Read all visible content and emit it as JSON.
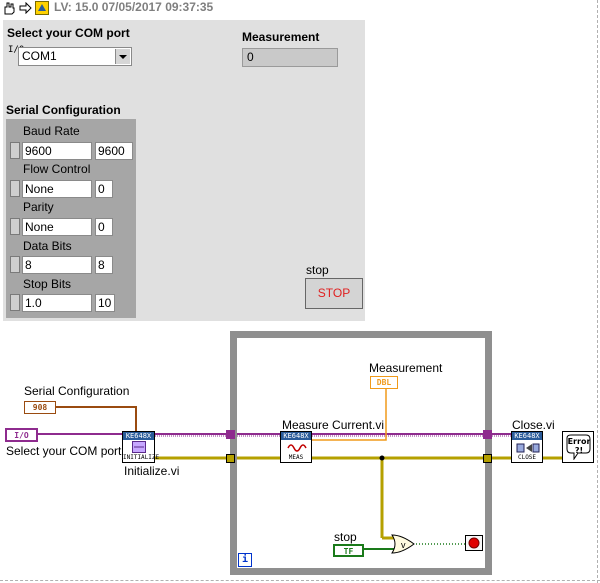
{
  "toolbar": {
    "version_label": "LV: 15.0 07/05/2017 09:37:35"
  },
  "front_panel": {
    "com_port": {
      "label": "Select your COM port",
      "prefix": "I/0",
      "value": "COM1"
    },
    "measurement": {
      "label": "Measurement",
      "value": "0"
    },
    "serial_config": {
      "label": "Serial Configuration",
      "fields": [
        {
          "label": "Baud Rate",
          "control": "9600",
          "indicator": "9600"
        },
        {
          "label": "Flow Control",
          "control": "None",
          "indicator": "0"
        },
        {
          "label": "Parity",
          "control": "None",
          "indicator": "0"
        },
        {
          "label": "Data Bits",
          "control": "8",
          "indicator": "8"
        },
        {
          "label": "Stop Bits",
          "control": "1.0",
          "indicator": "10"
        }
      ]
    },
    "stop": {
      "label": "stop",
      "button": "STOP"
    }
  },
  "block_diagram": {
    "serial_config_terminal": {
      "label": "Serial Configuration",
      "glyph": "908"
    },
    "com_port_terminal": {
      "label": "Select your COM port",
      "glyph": "I/O"
    },
    "initialize_vi": {
      "label": "Initialize.vi",
      "header": "KE648X",
      "footer": "INITIALIZE"
    },
    "measure_vi": {
      "label": "Measure Current.vi",
      "header": "KE648X",
      "footer": "MEAS"
    },
    "close_vi": {
      "label": "Close.vi",
      "header": "KE648X",
      "footer": "CLOSE"
    },
    "measurement_terminal": {
      "label": "Measurement",
      "glyph": "DBL"
    },
    "stop_terminal": {
      "label": "stop",
      "glyph": "TF"
    },
    "error_handler": {
      "glyph": "Error ?!"
    },
    "iteration_terminal": {
      "glyph": "i"
    }
  },
  "colors": {
    "panel_bg": "#e0e0e0",
    "cluster_bg": "#a6a6a6",
    "visa_wire": "#8e2b8e",
    "error_wire": "#b5a000",
    "numeric_wire": "#f09a1a",
    "boolean_wire": "#1a7a1a",
    "cluster_wire": "#9a4b10",
    "stop_text": "#e02020"
  }
}
